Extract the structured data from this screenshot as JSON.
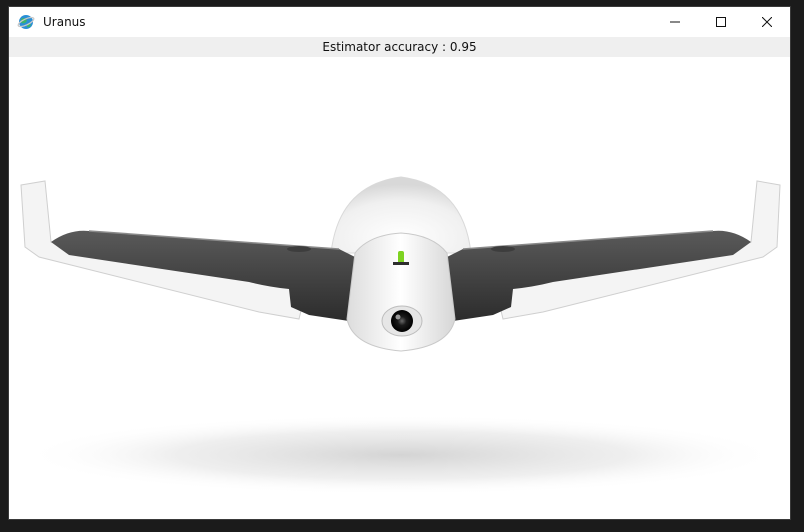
{
  "window": {
    "title": "Uranus",
    "icons": {
      "app": "globe-app-icon",
      "minimize": "minimize-icon",
      "maximize": "maximize-icon",
      "close": "close-icon"
    }
  },
  "status": {
    "label": "Estimator accuracy : 0.95"
  },
  "image": {
    "subject": "drone-image"
  }
}
